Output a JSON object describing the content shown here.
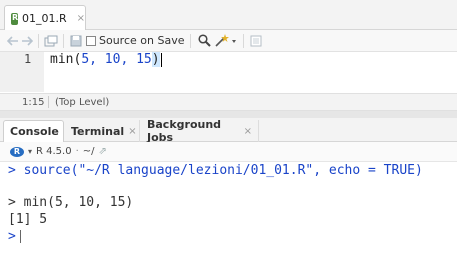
{
  "editor": {
    "tab": {
      "filename": "01_01.R",
      "close": "×"
    },
    "toolbar": {
      "source_on_save": "Source on Save"
    },
    "line_number": "1",
    "code": {
      "fn": "min(",
      "args": "5, 10, 15",
      "close": ")"
    },
    "status": {
      "position": "1:15",
      "scope": "(Top Level)"
    }
  },
  "console": {
    "tabs": [
      {
        "label": "Console"
      },
      {
        "label": "Terminal",
        "close": "×"
      },
      {
        "label": "Background Jobs",
        "close": "×"
      }
    ],
    "info": {
      "r_version": "R 4.5.0",
      "path": "~/"
    },
    "lines": {
      "source_cmd": "> source(\"~/R language/lezioni/01_01.R\", echo = TRUE)",
      "echo_cmd": "> min(5, 10, 15)",
      "result": "[1] 5",
      "prompt": ">"
    }
  }
}
